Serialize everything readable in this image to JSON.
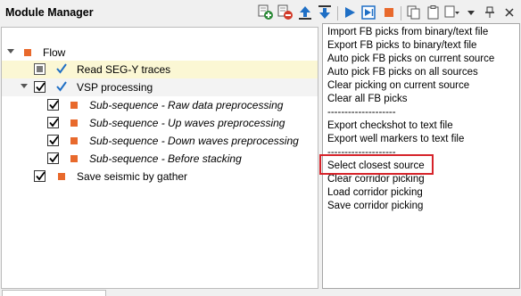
{
  "window": {
    "title": "Module Manager"
  },
  "toolbar": {
    "icons": [
      "add-module-icon",
      "remove-module-icon",
      "move-up-icon",
      "move-down-icon",
      "run-icon",
      "run-step-icon",
      "stop-icon",
      "copy-icon",
      "paste-icon",
      "dropdown-icon",
      "pin-icon",
      "close-icon"
    ],
    "colors": {
      "blue": "#1f6fc5",
      "orange": "#e8692c"
    }
  },
  "tree": {
    "root": {
      "label": "Flow"
    },
    "items": [
      {
        "label": "Read SEG-Y traces",
        "checked": "partial",
        "validated": true,
        "highlighted": true
      },
      {
        "label": "VSP processing",
        "checked": true,
        "validated": true,
        "expanded": true
      },
      {
        "label": "Sub-sequence - Raw data preprocessing",
        "checked": true,
        "italic": true
      },
      {
        "label": "Sub-sequence - Up waves preprocessing",
        "checked": true,
        "italic": true
      },
      {
        "label": "Sub-sequence - Down waves preprocessing",
        "checked": true,
        "italic": true
      },
      {
        "label": "Sub-sequence - Before stacking",
        "checked": true,
        "italic": true
      },
      {
        "label": "Save seismic by gather",
        "checked": true
      }
    ]
  },
  "context_menu": {
    "items": [
      "Import FB picks from binary/text file",
      "Export FB picks to binary/text file",
      "Auto pick FB picks on current source",
      "Auto pick FB picks on all sources",
      "Clear picking on current source",
      "Clear all FB picks",
      "--------------------",
      "Export checkshot to text file",
      "Export well markers to text file",
      "--------------------",
      "Select closest source",
      "Clear corridor picking",
      "Load corridor picking",
      "Save corridor picking"
    ],
    "highlighted_item": "Select closest source",
    "highlight_color": "#d6232a"
  }
}
